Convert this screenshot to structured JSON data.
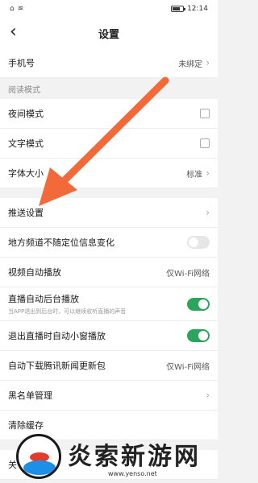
{
  "statusbar": {
    "left": "令 ⬝ 令",
    "battery_level": 0.65,
    "time": "12:14"
  },
  "header": {
    "back_icon": "chevron-left",
    "title": "设置"
  },
  "rows": {
    "phone": {
      "label": "手机号",
      "value": "未绑定"
    },
    "section_reading": "阅读模式",
    "night": {
      "label": "夜间模式"
    },
    "text": {
      "label": "文字模式"
    },
    "font": {
      "label": "字体大小",
      "value": "标准"
    },
    "push": {
      "label": "推送设置"
    },
    "local": {
      "label": "地方频道不随定位信息变化",
      "on": false
    },
    "video": {
      "label": "视频自动播放",
      "value": "仅Wi-Fi网络"
    },
    "live_bg": {
      "label": "直播自动后台播放",
      "sub": "当APP退出到后台时，可以继续收听直播的声音",
      "on": true
    },
    "live_exit": {
      "label": "退出直播时自动小窗播放",
      "on": true
    },
    "update": {
      "label": "自动下载腾讯新闻更新包",
      "value": "仅Wi-Fi网络"
    },
    "blacklist": {
      "label": "黑名单管理"
    },
    "cache": {
      "label": "清除缓存"
    },
    "about": {
      "label": "关"
    }
  },
  "watermark": {
    "brand": "炎索新游网",
    "url": "www.yenso.net"
  },
  "colors": {
    "toggle_on": "#2aa65a",
    "arrow": "#f26a3a"
  }
}
